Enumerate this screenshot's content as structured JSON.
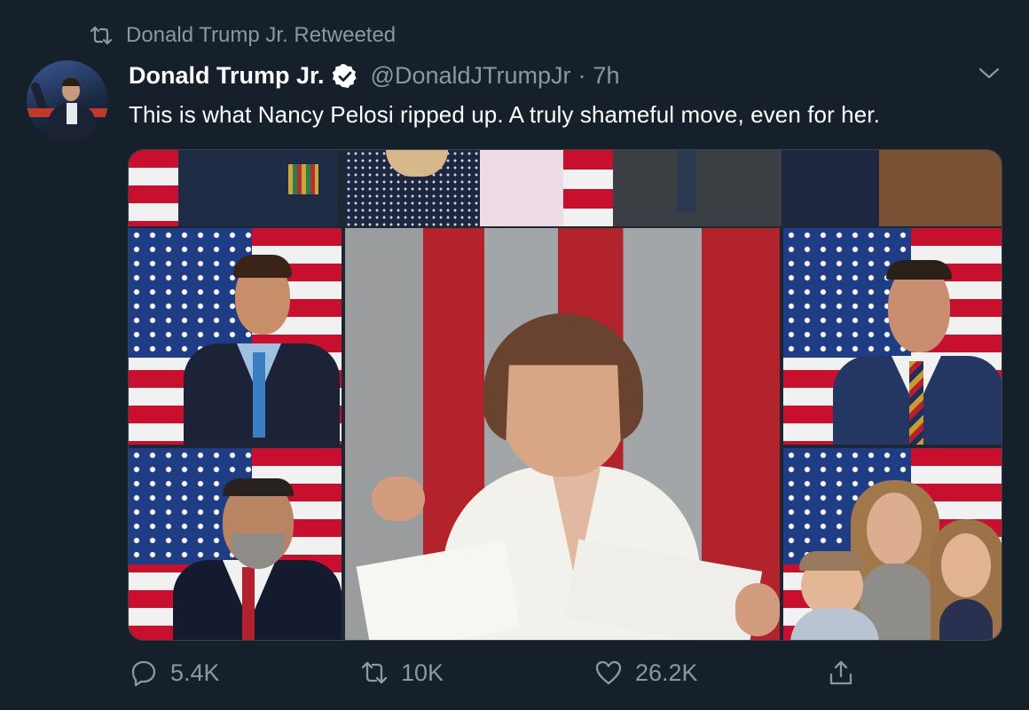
{
  "retweet": {
    "label": "Donald Trump Jr. Retweeted"
  },
  "tweet": {
    "author_name": "Donald Trump Jr.",
    "handle": "@DonaldJTrumpJr",
    "separator": "·",
    "time": "7h",
    "text": "This is what Nancy Pelosi ripped up. A truly shameful move, even for her."
  },
  "media": {
    "description_tiles": [
      "top-strip",
      "boy-portrait",
      "man-portrait-left",
      "center-pelosi",
      "man-portrait-right",
      "family-portrait"
    ]
  },
  "actions": {
    "replies": "5.4K",
    "retweets": "10K",
    "likes": "26.2K"
  },
  "colors": {
    "background": "#15202b",
    "muted": "#8899a6",
    "text": "#ffffff",
    "border": "#38444d"
  },
  "icons": {
    "retweet": "retweet-icon",
    "verified": "verified-badge-icon",
    "chevron": "chevron-down-icon",
    "reply": "reply-icon",
    "like": "heart-icon",
    "share": "share-icon"
  }
}
